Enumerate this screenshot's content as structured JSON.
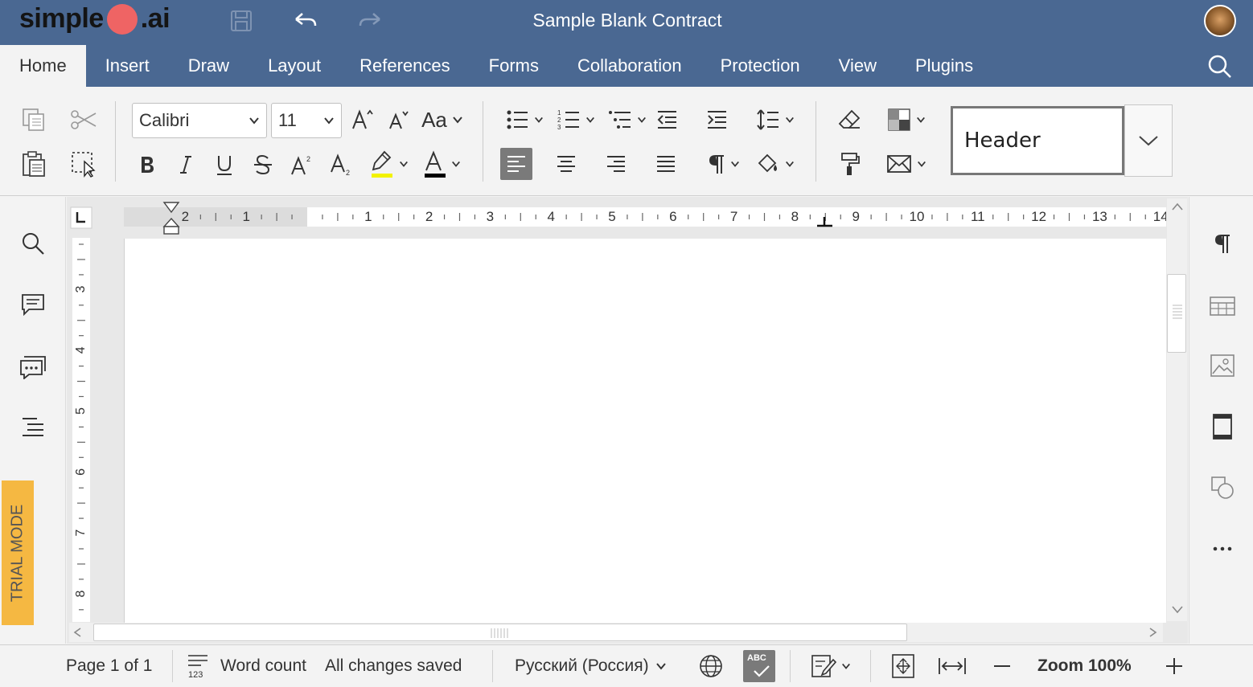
{
  "app": {
    "logo_left": "simple",
    "logo_right": ".ai",
    "title": "Sample Blank Contract"
  },
  "colors": {
    "header": "#4a6892",
    "logo_dot": "#ef6464",
    "trial": "#f5b842",
    "highlight": "#f2f200"
  },
  "tabs": [
    {
      "label": "Home",
      "active": true
    },
    {
      "label": "Insert"
    },
    {
      "label": "Draw"
    },
    {
      "label": "Layout"
    },
    {
      "label": "References"
    },
    {
      "label": "Forms"
    },
    {
      "label": "Collaboration"
    },
    {
      "label": "Protection"
    },
    {
      "label": "View"
    },
    {
      "label": "Plugins"
    }
  ],
  "toolbar": {
    "font_family": "Calibri",
    "font_size": "11",
    "change_case": "Aa",
    "style_name": "Header"
  },
  "ruler": {
    "left_numbers": [
      "2",
      "1"
    ],
    "numbers": [
      "1",
      "2",
      "3",
      "4",
      "5",
      "6",
      "7",
      "8",
      "9",
      "10",
      "11",
      "12",
      "13",
      "14"
    ],
    "vertical_numbers": [
      "3",
      "4",
      "5",
      "6",
      "7",
      "8"
    ]
  },
  "left_panel": {
    "trial_label": "TRIAL MODE"
  },
  "status": {
    "page": "Page 1 of 1",
    "word_count": "Word count",
    "saved": "All changes saved",
    "language": "Русский (Россия)",
    "spell_icon_text": "ABC",
    "zoom": "Zoom 100%",
    "word_count_icon_text": "123"
  }
}
